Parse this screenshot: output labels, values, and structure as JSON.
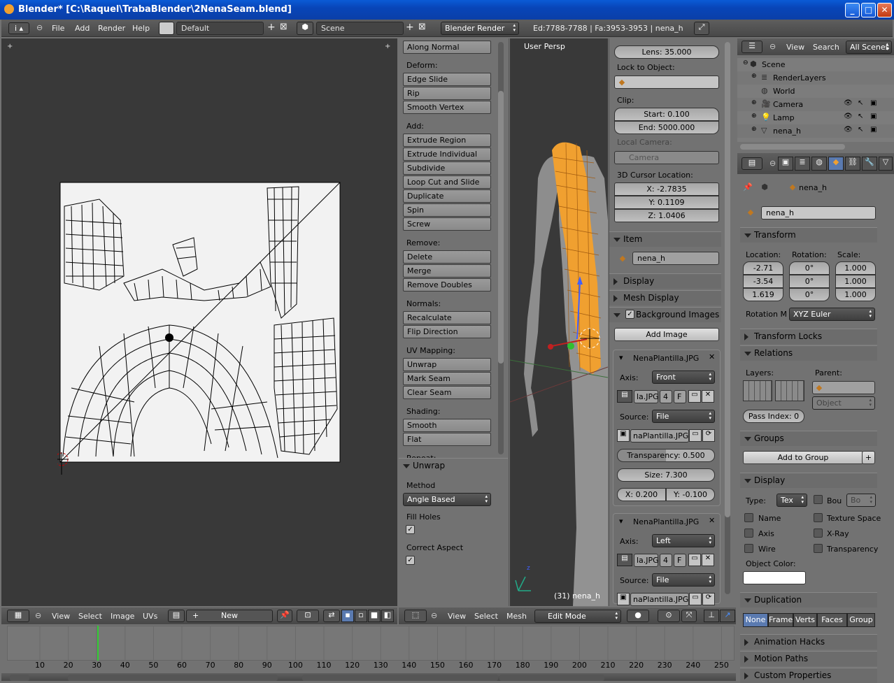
{
  "window": {
    "title": "Blender* [C:\\Raquel\\TrabaBlender\\2NenaSeam.blend]"
  },
  "info": {
    "menu": [
      "File",
      "Add",
      "Render",
      "Help"
    ],
    "layout": "Default",
    "scene": "Scene",
    "engine": "Blender Render",
    "stats": "Ed:7788-7788 | Fa:3953-3953 | nena_h"
  },
  "toolshelf": {
    "top_button": "Along Normal",
    "sections": [
      {
        "label": "Deform:",
        "buttons": [
          "Edge Slide",
          "Rip",
          "Smooth Vertex"
        ]
      },
      {
        "label": "Add:",
        "buttons": [
          "Extrude Region",
          "Extrude Individual",
          "Subdivide",
          "Loop Cut and Slide",
          "Duplicate",
          "Spin",
          "Screw"
        ]
      },
      {
        "label": "Remove:",
        "buttons": [
          "Delete",
          "Merge",
          "Remove Doubles"
        ]
      },
      {
        "label": "Normals:",
        "buttons": [
          "Recalculate",
          "Flip Direction"
        ]
      },
      {
        "label": "UV Mapping:",
        "buttons": [
          "Unwrap",
          "Mark Seam",
          "Clear Seam"
        ]
      },
      {
        "label": "Shading:",
        "buttons": [
          "Smooth",
          "Flat"
        ]
      },
      {
        "label": "Repeat:",
        "buttons": []
      }
    ],
    "unwrap": {
      "title": "Unwrap",
      "method_label": "Method",
      "method": "Angle Based",
      "fill_holes": "Fill Holes",
      "correct_aspect": "Correct Aspect"
    }
  },
  "viewport": {
    "view_label": "User Persp",
    "object_label": "(31) nena_h"
  },
  "nprops": {
    "lens": "Lens: 35.000",
    "lock_label": "Lock to Object:",
    "clip_label": "Clip:",
    "clip_start": "Start: 0.100",
    "clip_end": "End: 5000.000",
    "local_camera": "Local Camera:",
    "camera": "Camera",
    "cursor_label": "3D Cursor Location:",
    "cursor_x": "X: -2.7835",
    "cursor_y": "Y: 0.1109",
    "cursor_z": "Z: 1.0406",
    "item_title": "Item",
    "item_name": "nena_h",
    "display": "Display",
    "mesh_display": "Mesh Display",
    "bg_images": "Background Images",
    "add_image": "Add Image",
    "images": [
      {
        "name": "NenaPlantilla.JPG",
        "axis_label": "Axis:",
        "axis": "Front",
        "file": "la.JPG",
        "users": "4",
        "fake": "F",
        "source_label": "Source:",
        "source": "File",
        "path": "naPlantilla.JPG"
      },
      {
        "name": "NenaPlantilla.JPG",
        "axis_label": "Axis:",
        "axis": "Left",
        "file": "la.JPG",
        "users": "4",
        "fake": "F",
        "source_label": "Source:",
        "source": "File",
        "path": "naPlantilla.JPG"
      }
    ],
    "transparency": "Transparency: 0.500",
    "size": "Size: 7.300",
    "offset_x": "X: 0.200",
    "offset_y": "Y: -0.100"
  },
  "outliner": {
    "menu": [
      "View",
      "Search"
    ],
    "filter": "All Scenes",
    "items": [
      {
        "label": "Scene",
        "indent": 0
      },
      {
        "label": "RenderLayers",
        "indent": 1
      },
      {
        "label": "World",
        "indent": 1
      },
      {
        "label": "Camera",
        "indent": 1
      },
      {
        "label": "Lamp",
        "indent": 1
      },
      {
        "label": "nena_h",
        "indent": 1
      }
    ]
  },
  "props": {
    "breadcrumb": "nena_h",
    "object_name": "nena_h",
    "transform": "Transform",
    "location_label": "Location:",
    "rotation_label": "Rotation:",
    "scale_label": "Scale:",
    "location": [
      "-2.71",
      "-3.54",
      "1.619"
    ],
    "rotation": [
      "0°",
      "0°",
      "0°"
    ],
    "scale": [
      "1.000",
      "1.000",
      "1.000"
    ],
    "rotation_mode_label": "Rotation M",
    "rotation_mode": "XYZ Euler",
    "transform_locks": "Transform Locks",
    "relations": "Relations",
    "layers_label": "Layers:",
    "parent_label": "Parent:",
    "parent_type": "Object",
    "pass_index": "Pass Index: 0",
    "groups": "Groups",
    "add_to_group": "Add to Group",
    "display": "Display",
    "type_label": "Type:",
    "type": "Tex",
    "bounds": "Bou",
    "bounds_type": "Bo",
    "checks_left": [
      "Name",
      "Axis",
      "Wire"
    ],
    "checks_right": [
      "Texture Space",
      "X-Ray",
      "Transparency"
    ],
    "object_color": "Object Color:",
    "duplication": "Duplication",
    "dup_tabs": [
      "None",
      "Frames",
      "Verts",
      "Faces",
      "Group"
    ],
    "animation_hacks": "Animation Hacks",
    "motion_paths": "Motion Paths",
    "custom_properties": "Custom Properties"
  },
  "uv_header": {
    "menu": [
      "View",
      "Select",
      "Image",
      "UVs"
    ],
    "new": "New"
  },
  "view3d_header": {
    "menu": [
      "View",
      "Select",
      "Mesh"
    ],
    "mode": "Edit Mode"
  },
  "timeline": {
    "ticks": [
      "10",
      "20",
      "30",
      "40",
      "50",
      "60",
      "70",
      "80",
      "90",
      "100",
      "110",
      "120",
      "130",
      "140",
      "150",
      "160",
      "170",
      "180",
      "190",
      "200",
      "210",
      "220",
      "230",
      "240",
      "250"
    ],
    "current": 31
  }
}
